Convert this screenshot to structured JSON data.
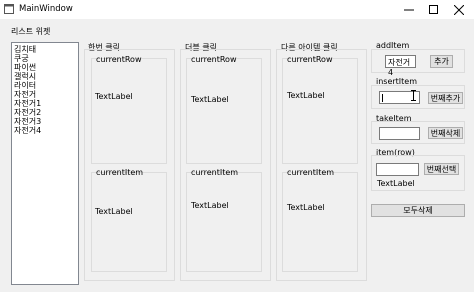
{
  "window": {
    "title": "MainWindow"
  },
  "list_title": "리스트 위젯",
  "list_items": [
    "김치태",
    "쿠궁",
    "파이썬",
    "갤럭시",
    "라이터",
    "자전거",
    "자전거1",
    "자전거2",
    "자전거3",
    "자전거4"
  ],
  "groups": [
    {
      "title": "한번 클릭",
      "row_label": "currentRow",
      "row_value": "TextLabel",
      "item_label": "currentItem",
      "item_value": "TextLabel"
    },
    {
      "title": "더블 클릭",
      "row_label": "currentRow",
      "row_value": "TextLabel",
      "item_label": "currentItem",
      "item_value": "TextLabel"
    },
    {
      "title": "다른 아이템 클릭",
      "row_label": "currentRow",
      "row_value": "TextLabel",
      "item_label": "currentItem",
      "item_value": "TextLabel"
    }
  ],
  "add_item": {
    "label": "addItem",
    "value": "자전거4",
    "button": "추가"
  },
  "insert_item": {
    "label": "insertItem",
    "value": "",
    "button": "번째추가"
  },
  "take_item": {
    "label": "takeItem",
    "value": "",
    "button": "번째삭제"
  },
  "item_row": {
    "label": "item(row)",
    "value": "",
    "button": "번째선택",
    "result": "TextLabel"
  },
  "clear_button": "모두삭제"
}
